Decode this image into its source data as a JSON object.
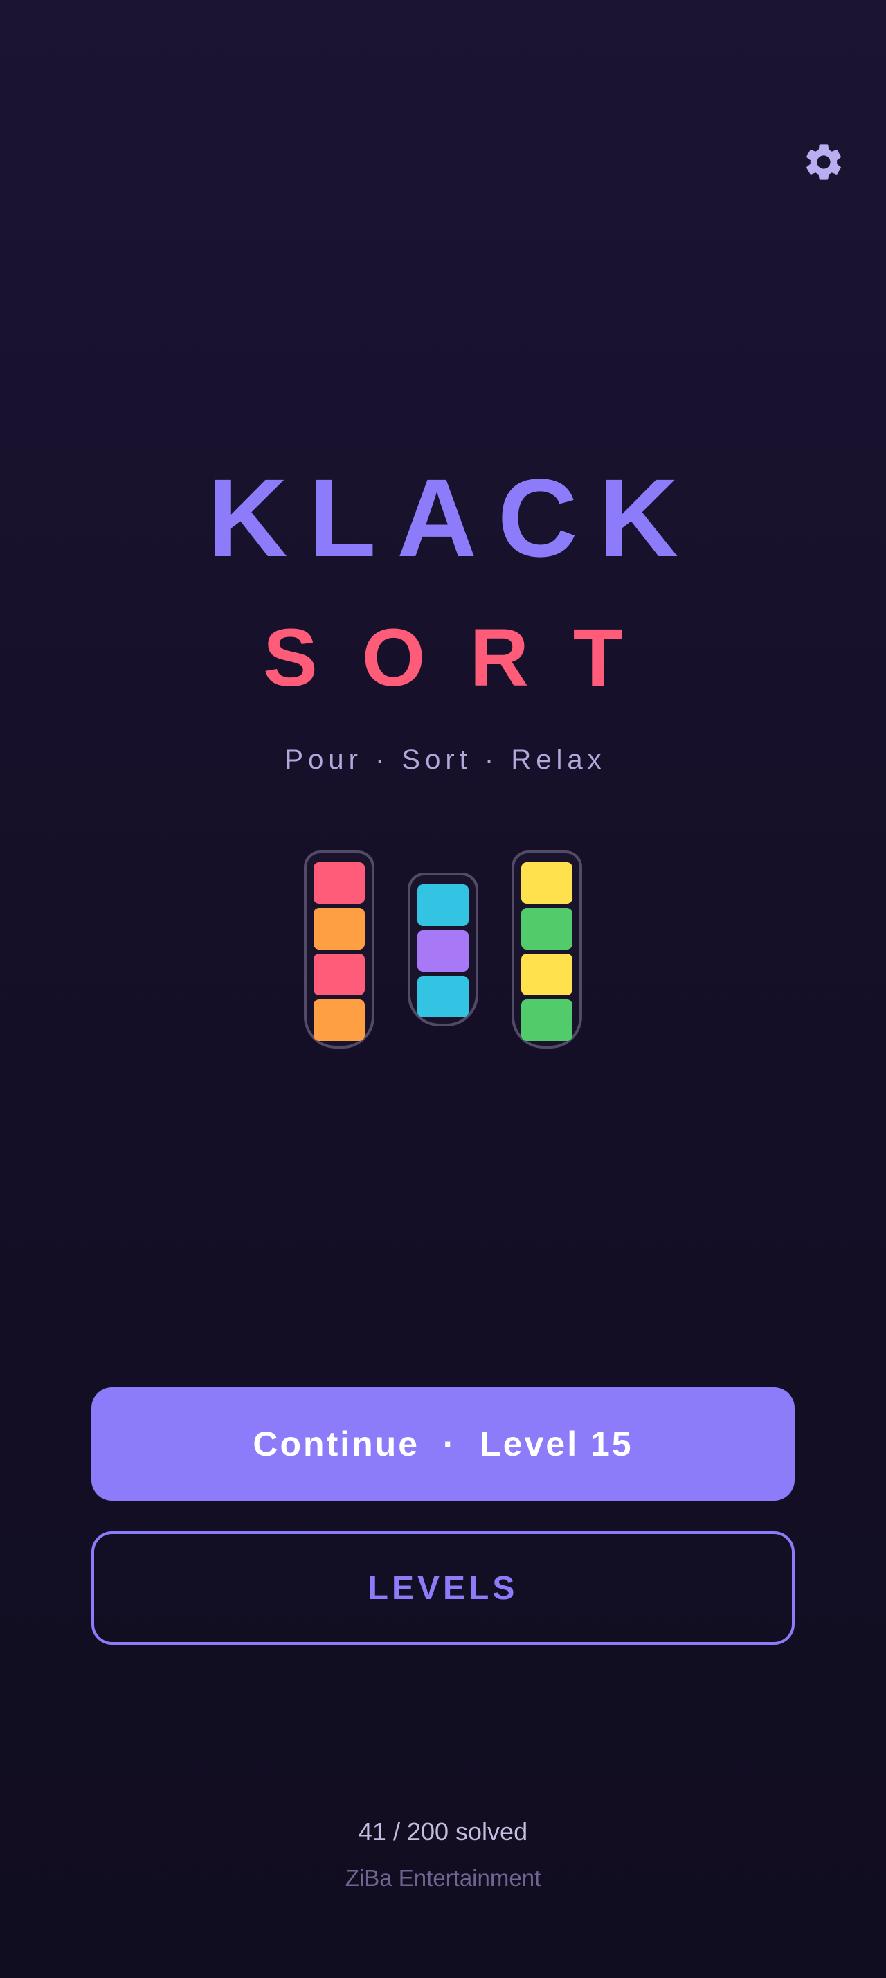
{
  "settings": {
    "icon": "gear-icon",
    "color": "#b9aef0"
  },
  "title": {
    "line1": "KLACK",
    "line2": "SORT"
  },
  "tagline": "Pour · Sort · Relax",
  "illustration": {
    "tubes": [
      {
        "blocks": [
          "#ff5c7a",
          "#ff9f43",
          "#ff5c7a",
          "#ff9f43"
        ]
      },
      {
        "blocks": [
          "#33c3e3",
          "#a779f7",
          "#33c3e3"
        ]
      },
      {
        "blocks": [
          "#ffe14d",
          "#52cc6b",
          "#ffe14d",
          "#52cc6b"
        ]
      }
    ]
  },
  "buttons": {
    "continue_label": "Continue  ·  Level 15",
    "levels_label": "LEVELS"
  },
  "footer": {
    "progress": "41 / 200 solved",
    "company": "ZiBa Entertainment"
  },
  "colors": {
    "accent": "#8c7cf9",
    "secondary": "#ff5c7a",
    "background": "#16112a"
  }
}
